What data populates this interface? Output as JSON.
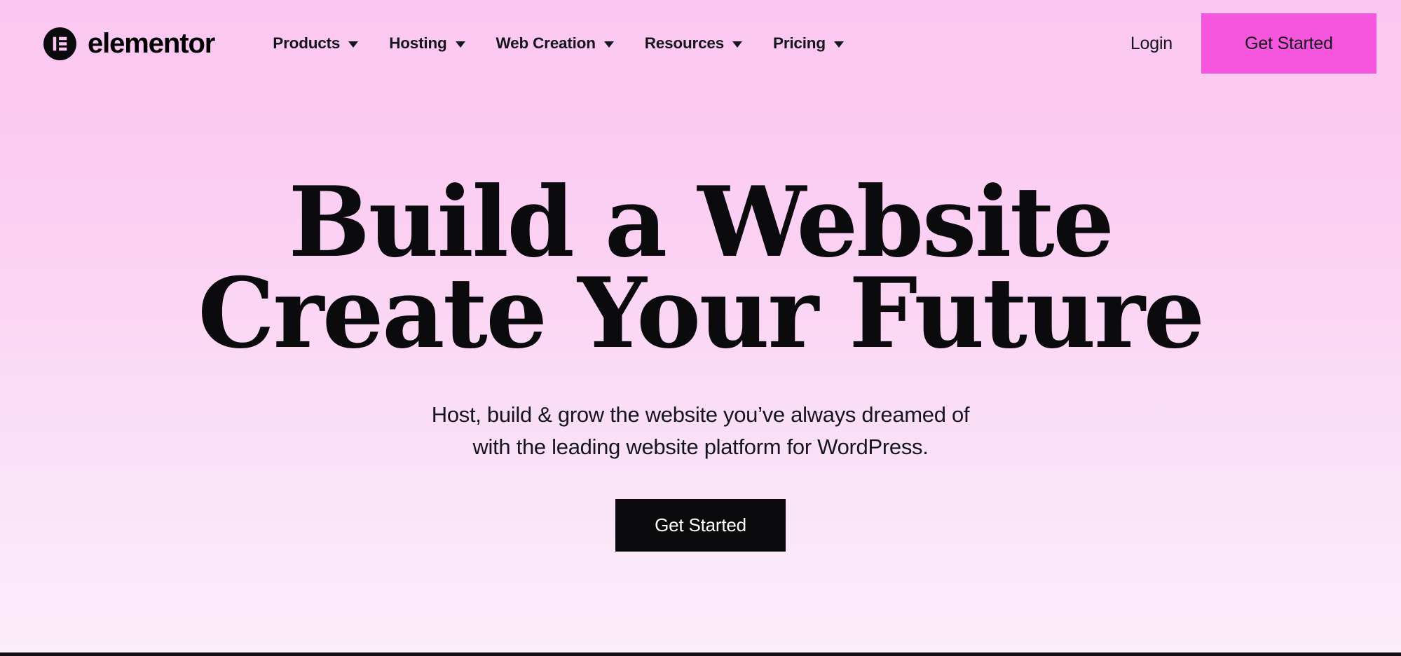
{
  "header": {
    "brand": {
      "name": "elementor",
      "logo_icon": "elementor-logo-icon"
    },
    "nav_items": [
      {
        "label": "Products",
        "icon": "chevron-down-icon"
      },
      {
        "label": "Hosting",
        "icon": "chevron-down-icon"
      },
      {
        "label": "Web Creation",
        "icon": "chevron-down-icon"
      },
      {
        "label": "Resources",
        "icon": "chevron-down-icon"
      },
      {
        "label": "Pricing",
        "icon": "chevron-down-icon"
      }
    ],
    "login_label": "Login",
    "cta_label": "Get Started",
    "cta_color": "#F656DE"
  },
  "hero": {
    "heading_line1": "Build a Website",
    "heading_line2": "Create Your Future",
    "sub_line1": "Host, build & grow the website you’ve always dreamed of",
    "sub_line2": "with the leading website platform for WordPress.",
    "cta_label": "Get Started",
    "cta_background": "#0B0B0D",
    "cta_text_color": "#FFFFFF"
  },
  "theme": {
    "background_top": "#FBC7F2",
    "background_bottom": "#FCEDFA",
    "text_color": "#15151C",
    "divider_color": "#100F14"
  }
}
